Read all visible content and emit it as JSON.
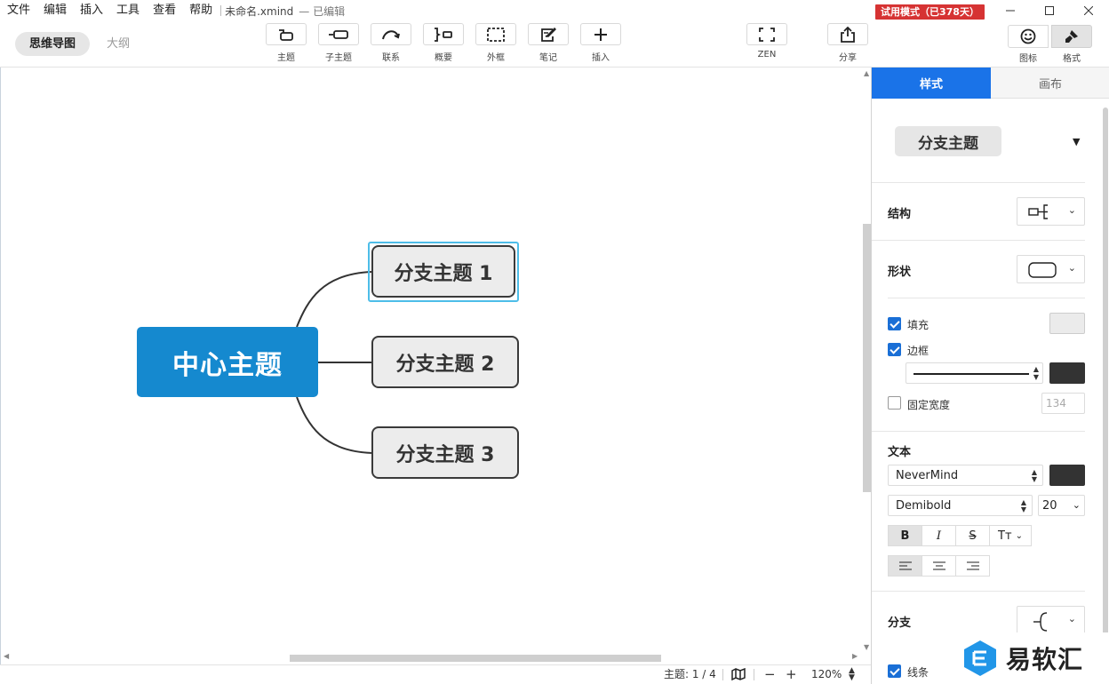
{
  "menubar": {
    "items": [
      "文件",
      "编辑",
      "插入",
      "工具",
      "查看",
      "帮助"
    ],
    "doc_title": "未命名.xmind",
    "doc_status": "— 已编辑",
    "trial_badge": "试用模式（已378天）"
  },
  "toolbar": {
    "view_tabs": [
      "思维导图",
      "大纲"
    ],
    "tools": [
      {
        "label": "主题",
        "icon": "topic-icon"
      },
      {
        "label": "子主题",
        "icon": "subtopic-icon"
      },
      {
        "label": "联系",
        "icon": "relationship-icon"
      },
      {
        "label": "概要",
        "icon": "summary-icon"
      },
      {
        "label": "外框",
        "icon": "boundary-icon"
      },
      {
        "label": "笔记",
        "icon": "note-icon"
      },
      {
        "label": "插入",
        "icon": "plus-icon"
      }
    ],
    "zen_label": "ZEN",
    "share_label": "分享",
    "icons_label": "图标",
    "format_label": "格式"
  },
  "mindmap": {
    "central": "中心主题",
    "branches": [
      "分支主题 1",
      "分支主题 2",
      "分支主题 3"
    ]
  },
  "statusbar": {
    "topic_count": "主题: 1 / 4",
    "zoom_out": "−",
    "zoom_in": "+",
    "zoom_level": "120%"
  },
  "panel": {
    "tabs": [
      "样式",
      "画布"
    ],
    "style_preset": "分支主题",
    "structure_label": "结构",
    "shape_label": "形状",
    "fill_label": "填充",
    "fill_checked": true,
    "border_label": "边框",
    "border_checked": true,
    "fixed_width_label": "固定宽度",
    "fixed_width_checked": false,
    "fixed_width_value": "134",
    "text_label": "文本",
    "font_family": "NeverMind",
    "font_weight": "Demibold",
    "font_size": "20",
    "format_buttons": [
      "B",
      "I",
      "S",
      "Tт"
    ],
    "align_active": "left",
    "branch_label": "分支",
    "line_label": "线条",
    "line_checked": true
  },
  "colors": {
    "central_fill": "#1589cf",
    "branch_fill": "#ececec",
    "branch_border": "#3a3a3a",
    "selection": "#4dbde8",
    "accent_tab": "#1a73e8",
    "trial_badge": "#d63333"
  },
  "watermark": {
    "text": "易软汇"
  }
}
